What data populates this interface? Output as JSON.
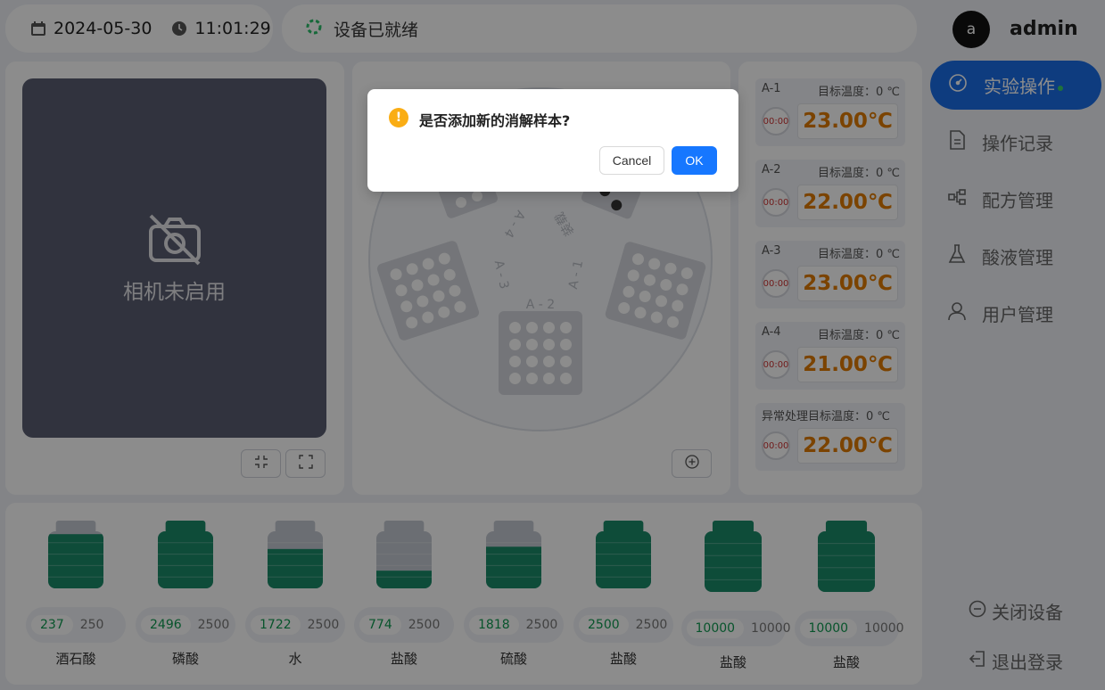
{
  "header": {
    "date": "2024-05-30",
    "time": "11:01:29",
    "status": "设备已就绪"
  },
  "user": {
    "avatar_letter": "a",
    "name": "admin"
  },
  "camera": {
    "label": "相机未启用"
  },
  "rotor": {
    "positions": [
      "A - 1",
      "A - 2",
      "A - 3",
      "A - 4"
    ],
    "center_mark": "装载"
  },
  "temps": [
    {
      "name": "A-1",
      "target": "目标温度：0 ℃",
      "timer": "00:00",
      "value": "23.00℃"
    },
    {
      "name": "A-2",
      "target": "目标温度：0 ℃",
      "timer": "00:00",
      "value": "22.00℃"
    },
    {
      "name": "A-3",
      "target": "目标温度：0 ℃",
      "timer": "00:00",
      "value": "23.00℃"
    },
    {
      "name": "A-4",
      "target": "目标温度：0 ℃",
      "timer": "00:00",
      "value": "21.00℃"
    },
    {
      "name": "",
      "target": "异常处理目标温度：0 ℃",
      "timer": "00:00",
      "value": "22.00℃"
    }
  ],
  "menu": {
    "items": [
      {
        "label": "实验操作",
        "icon": "gauge-icon",
        "active": true
      },
      {
        "label": "操作记录",
        "icon": "document-icon"
      },
      {
        "label": "配方管理",
        "icon": "flow-icon"
      },
      {
        "label": "酸液管理",
        "icon": "flask-icon"
      },
      {
        "label": "用户管理",
        "icon": "user-icon"
      }
    ],
    "close_device": "关闭设备",
    "logout": "退出登录"
  },
  "bottles": [
    {
      "name": "酒石酸",
      "current": "237",
      "max": "250",
      "fill": 0.95
    },
    {
      "name": "磷酸",
      "current": "2496",
      "max": "2500",
      "fill": 1.0
    },
    {
      "name": "水",
      "current": "1722",
      "max": "2500",
      "fill": 0.69
    },
    {
      "name": "盐酸",
      "current": "774",
      "max": "2500",
      "fill": 0.31
    },
    {
      "name": "硫酸",
      "current": "1818",
      "max": "2500",
      "fill": 0.73
    },
    {
      "name": "盐酸",
      "current": "2500",
      "max": "2500",
      "fill": 1.0
    },
    {
      "name": "盐酸",
      "current": "10000",
      "max": "10000",
      "fill": 1.0
    },
    {
      "name": "盐酸",
      "current": "10000",
      "max": "10000",
      "fill": 1.0
    }
  ],
  "dialog": {
    "title": "是否添加新的消解样本?",
    "cancel": "Cancel",
    "ok": "OK"
  },
  "colors": {
    "accent": "#1b6ee8",
    "temperature": "#e07b00",
    "liquid": "#1a8a68",
    "warning": "#faad14",
    "ok_button": "#1677ff"
  }
}
